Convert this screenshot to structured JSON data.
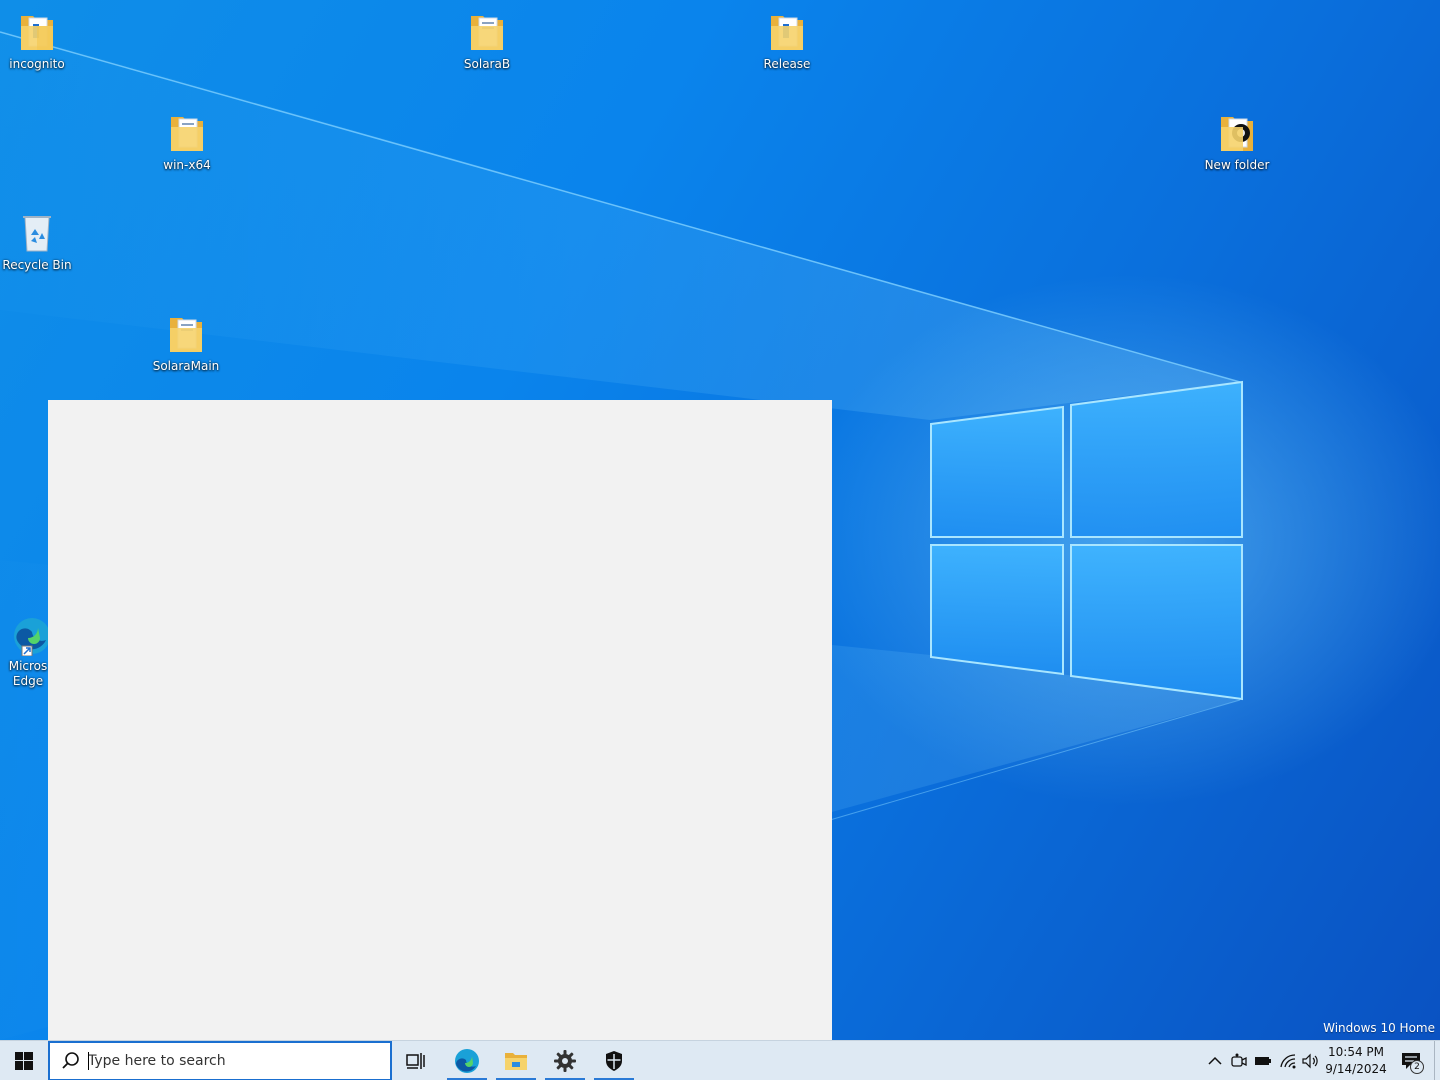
{
  "desktop": {
    "icons": [
      {
        "label": "incognito",
        "icon": "folder-document-icon"
      },
      {
        "label": "SolaraB",
        "icon": "folder-document-icon"
      },
      {
        "label": "Release",
        "icon": "folder-document-icon"
      },
      {
        "label": "win-x64",
        "icon": "folder-document-icon"
      },
      {
        "label": "New folder",
        "icon": "folder-image-icon"
      },
      {
        "label": "Recycle Bin",
        "icon": "recycle-bin-icon"
      },
      {
        "label": "SolaraMain",
        "icon": "folder-document-icon"
      },
      {
        "label": "Micros\nEdge",
        "icon": "edge-shortcut-icon"
      }
    ],
    "watermark": "Windows 10 Home"
  },
  "taskbar": {
    "search_placeholder": "Type here to search",
    "pinned": [
      {
        "name": "Task View",
        "icon": "task-view-icon",
        "active": false
      },
      {
        "name": "Microsoft Edge",
        "icon": "edge-icon",
        "active": true
      },
      {
        "name": "File Explorer",
        "icon": "file-explorer-icon",
        "active": true
      },
      {
        "name": "Settings",
        "icon": "gear-icon",
        "active": true
      },
      {
        "name": "Windows Security",
        "icon": "shield-icon",
        "active": true
      }
    ],
    "tray": {
      "time": "10:54 PM",
      "date": "9/14/2024",
      "notification_count": "2"
    }
  },
  "colors": {
    "accent": "#2a7ad6",
    "taskbar": "#dee9f3",
    "window": "#f2f2f2",
    "folder": "#f3c74e"
  }
}
